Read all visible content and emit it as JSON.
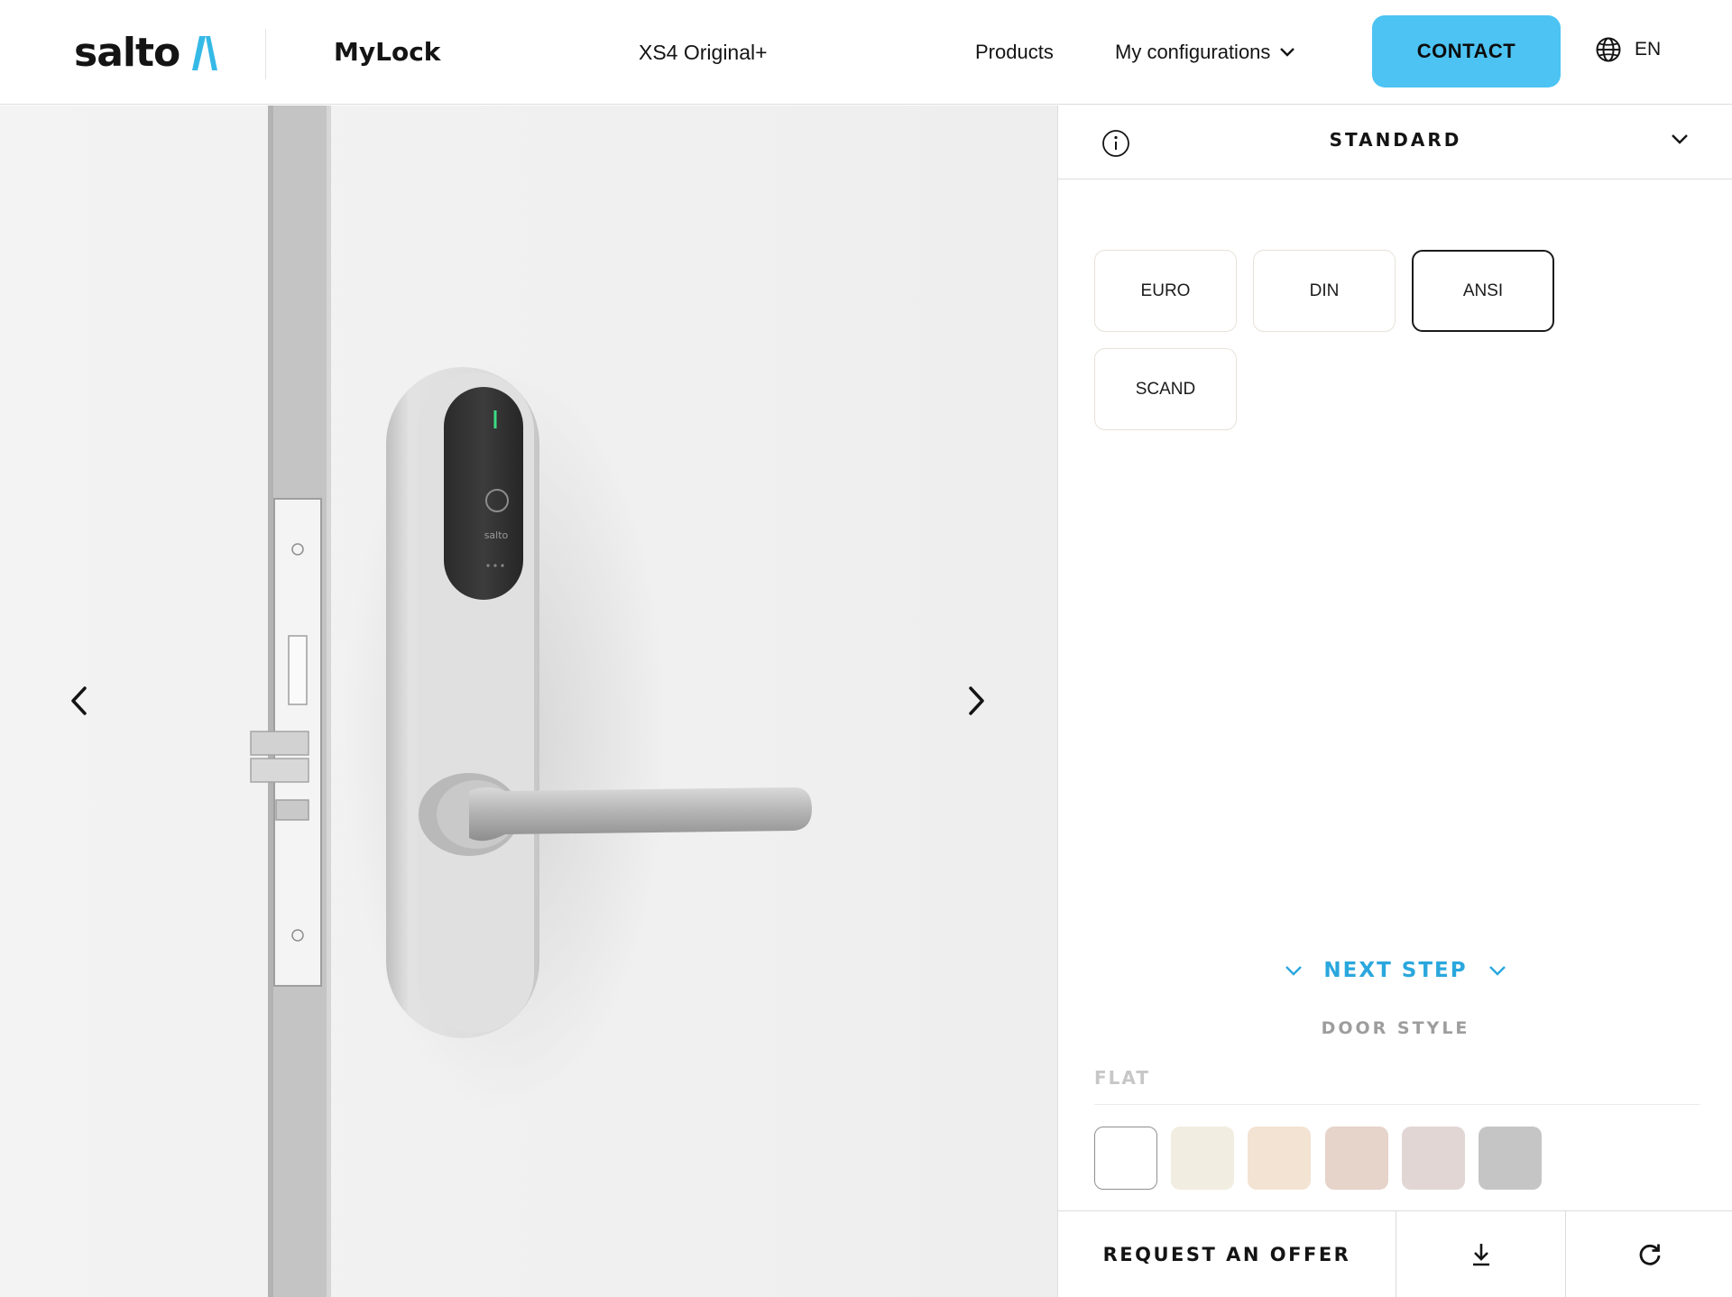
{
  "header": {
    "logo_text": "salto",
    "brand": "MyLock",
    "model": "XS4 Original+",
    "nav": {
      "products": "Products",
      "my_configurations": "My configurations"
    },
    "contact_label": "CONTACT",
    "language": "EN",
    "accent_color": "#4cc3f3"
  },
  "hero": {
    "lock_badge_text": "salto",
    "icons": [
      "chevron-left-icon",
      "chevron-right-icon"
    ]
  },
  "panel": {
    "section_title": "STANDARD",
    "standards": [
      {
        "label": "EURO",
        "selected": false
      },
      {
        "label": "DIN",
        "selected": false
      },
      {
        "label": "ANSI",
        "selected": true
      },
      {
        "label": "SCAND",
        "selected": false
      }
    ],
    "next_step_label": "NEXT STEP",
    "next_section_label": "DOOR STYLE",
    "door_type_label": "FLAT",
    "swatches": [
      {
        "color": "#ffffff",
        "selected": true
      },
      {
        "color": "#f1ede0",
        "selected": false
      },
      {
        "color": "#f3e3d2",
        "selected": false
      },
      {
        "color": "#e6d3c9",
        "selected": false
      },
      {
        "color": "#e2d6d5",
        "selected": false
      },
      {
        "color": "#c5c5c5",
        "selected": false
      }
    ],
    "request_offer_label": "REQUEST AN OFFER",
    "next_step_color": "#2aa7dd"
  }
}
